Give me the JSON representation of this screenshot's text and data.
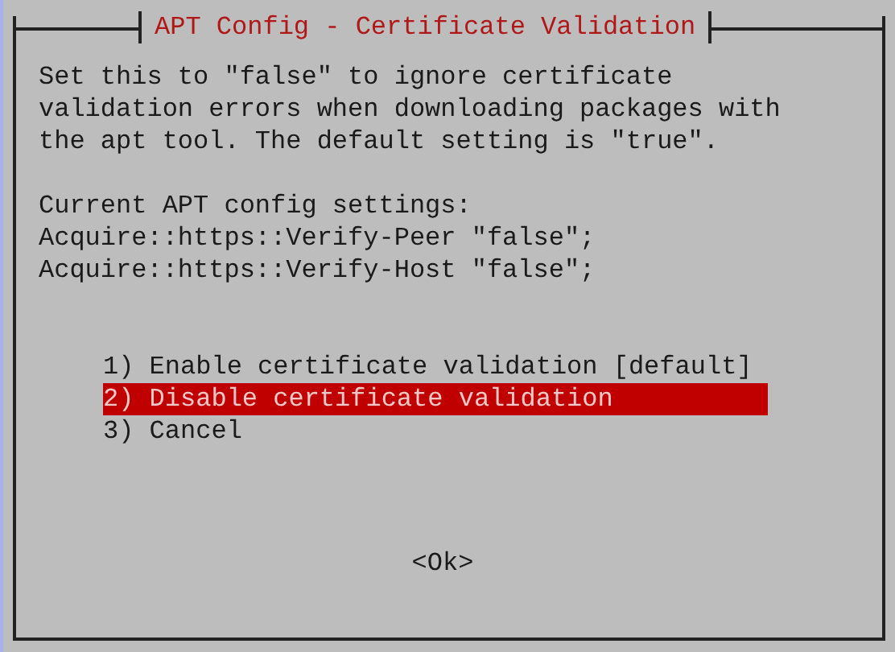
{
  "dialog": {
    "title": "APT Config - Certificate Validation",
    "description": "Set this to \"false\" to ignore certificate validation errors when downloading packages with the apt tool. The default setting is \"true\".",
    "settings_heading": "Current APT config settings:",
    "settings": [
      "Acquire::https::Verify-Peer \"false\";",
      "Acquire::https::Verify-Host \"false\";"
    ],
    "menu": [
      {
        "label": "1) Enable certificate validation [default]",
        "selected": false
      },
      {
        "label": "2) Disable certificate validation",
        "selected": true
      },
      {
        "label": "3) Cancel",
        "selected": false
      }
    ],
    "ok_button": "<Ok>"
  }
}
